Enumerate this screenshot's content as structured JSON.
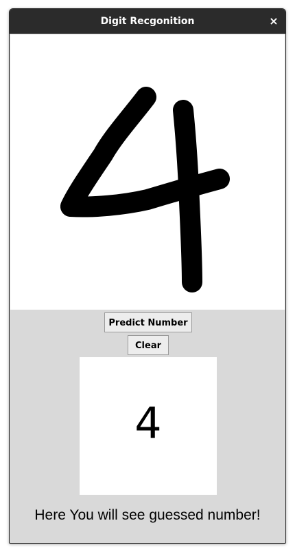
{
  "window": {
    "title": "Digit Recgonition",
    "close_icon": "×"
  },
  "canvas": {
    "drawn_digit": "4",
    "stroke_color": "#000000",
    "background": "#ffffff"
  },
  "buttons": {
    "predict_label": "Predict Number",
    "clear_label": "Clear"
  },
  "result": {
    "digit": "4"
  },
  "status": {
    "text": "Here You will see guessed number!"
  },
  "colors": {
    "titlebar": "#2b2b2b",
    "panel_bg": "#d9d9d9",
    "button_bg": "#ededed"
  }
}
